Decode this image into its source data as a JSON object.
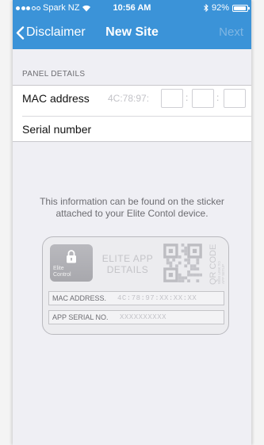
{
  "status_bar": {
    "carrier": "Spark NZ",
    "time": "10:56 AM",
    "battery": "92%",
    "battery_level": 0.92
  },
  "nav": {
    "back_label": "Disclaimer",
    "title": "New Site",
    "next_label": "Next"
  },
  "panel_details": {
    "header": "PANEL DETAILS",
    "mac_label": "MAC address",
    "mac_prefix": "4C:78:97:",
    "mac_sep": ":",
    "mac_fields": [
      "",
      "",
      ""
    ],
    "serial_label": "Serial number",
    "serial_value": ""
  },
  "info_text": "This information can be found on the sticker attached to your Elite Contol device.",
  "sticker": {
    "brand": "Elite\nControl",
    "app_details": "ELITE APP\nDETAILS",
    "qr_title": "QR CODE",
    "qr_subtitle": "WEB LINK TO\nAPP SETUP",
    "mac_label": "MAC ADDRESS.",
    "mac_value": "4C:78:97:XX:XX:XX",
    "serial_label": "APP SERIAL NO.",
    "serial_value": "XXXXXXXXXX"
  },
  "colors": {
    "nav_bar": "#3b93d8",
    "background": "#efeff4"
  }
}
